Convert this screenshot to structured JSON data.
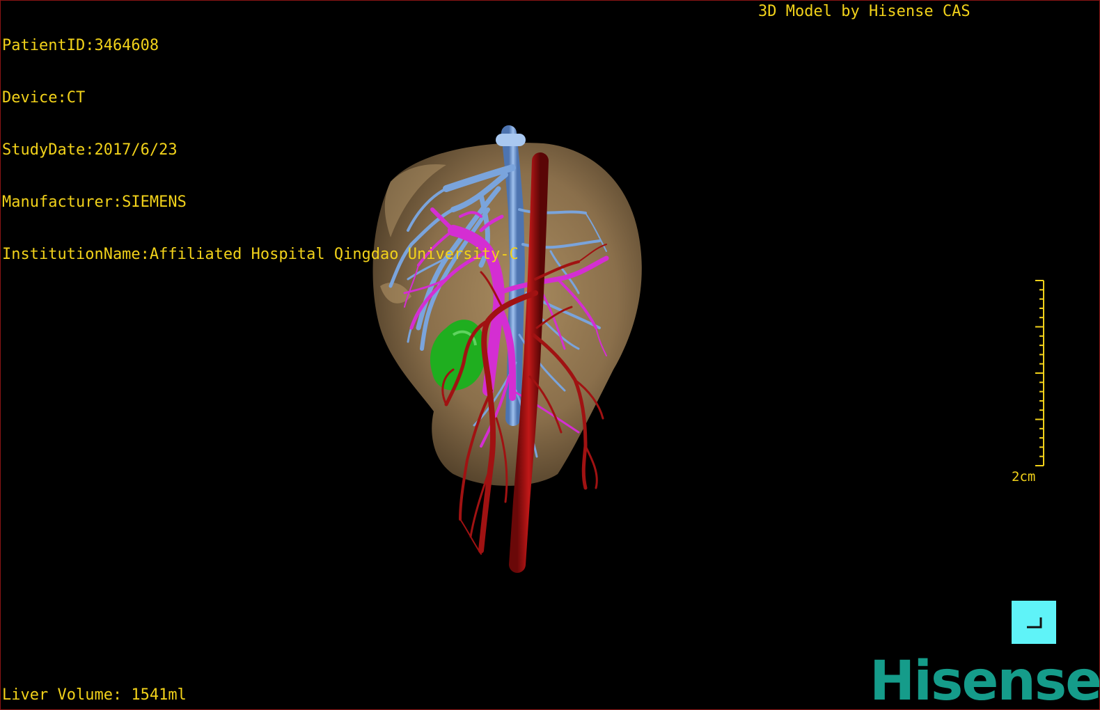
{
  "patient_info": {
    "patient_id": "PatientID:3464608",
    "device": "Device:CT",
    "study_date": "StudyDate:2017/6/23",
    "manufacturer": "Manufacturer:SIEMENS",
    "institution": "InstitutionName:Affiliated Hospital Qingdao University-C"
  },
  "credit": "3D Model by Hisense CAS",
  "liver_volume": "Liver Volume: 1541ml",
  "scale": {
    "label": "2cm"
  },
  "brand": "Hisense",
  "corner_button": {
    "icon": "corner-bracket-icon"
  },
  "colors": {
    "overlay_text": "#f2d21a",
    "liver": "#8b7250",
    "hepatic_vein": "#7aa4dc",
    "portal_vein": "#d42ed2",
    "artery": "#a01212",
    "gallbladder": "#1fae1f",
    "button": "#5ff3f8",
    "brand": "#159c8a",
    "frame": "#8a1414"
  }
}
